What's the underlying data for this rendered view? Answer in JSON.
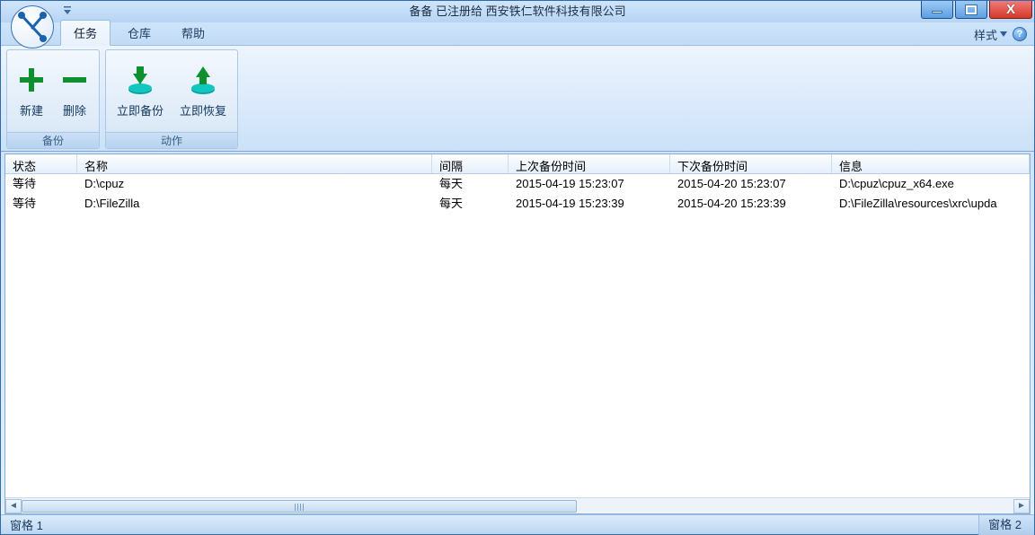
{
  "title": "备备  已注册给  西安铁仁软件科技有限公司",
  "tabs": {
    "items": [
      "任务",
      "仓库",
      "帮助"
    ],
    "active": 0,
    "style_label": "样式",
    "help_glyph": "?"
  },
  "ribbon": {
    "groups": [
      {
        "label": "备份",
        "buttons": [
          {
            "id": "new",
            "label": "新建"
          },
          {
            "id": "delete",
            "label": "删除"
          }
        ]
      },
      {
        "label": "动作",
        "buttons": [
          {
            "id": "backup-now",
            "label": "立即备份"
          },
          {
            "id": "restore-now",
            "label": "立即恢复"
          }
        ]
      }
    ]
  },
  "table": {
    "columns": [
      "状态",
      "名称",
      "间隔",
      "上次备份时间",
      "下次备份时间",
      "信息"
    ],
    "rows": [
      [
        "等待",
        "D:\\cpuz",
        "每天",
        "2015-04-19 15:23:07",
        "2015-04-20 15:23:07",
        "D:\\cpuz\\cpuz_x64.exe"
      ],
      [
        "等待",
        "D:\\FileZilla",
        "每天",
        "2015-04-19 15:23:39",
        "2015-04-20 15:23:39",
        "D:\\FileZilla\\resources\\xrc\\upda"
      ]
    ]
  },
  "statusbar": {
    "left": "窗格 1",
    "right": "窗格 2"
  }
}
